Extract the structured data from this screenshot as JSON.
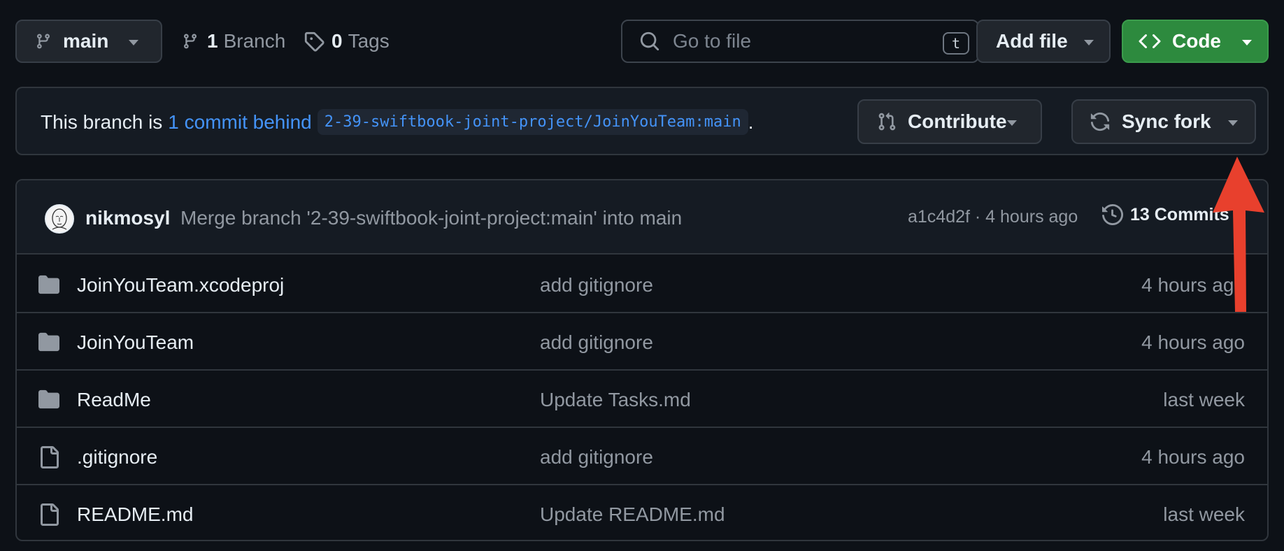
{
  "toolbar": {
    "branch": {
      "label": "main",
      "icon": "git-branch-icon"
    },
    "branches": {
      "count": "1",
      "label": "Branch",
      "icon": "git-branch-icon"
    },
    "tags": {
      "count": "0",
      "label": "Tags",
      "icon": "tag-icon"
    },
    "search": {
      "placeholder": "Go to file",
      "shortcut": "t",
      "icon": "search-icon"
    },
    "add_file": {
      "label": "Add file"
    },
    "code": {
      "label": "Code",
      "icon": "code-icon",
      "color": "#2d8a3e"
    }
  },
  "branch_status": {
    "prefix": "This branch is",
    "link": "1 commit behind",
    "upstream": "2-39-swiftbook-joint-project/JoinYouTeam:main",
    "suffix": ".",
    "contribute": {
      "label": "Contribute",
      "icon": "git-pull-request-icon"
    },
    "sync": {
      "label": "Sync fork",
      "icon": "sync-icon"
    }
  },
  "latest_commit": {
    "author": "nikmosyl",
    "message": "Merge branch '2-39-swiftbook-joint-project:main' into main",
    "meta": "a1c4d2f · 4 hours ago",
    "commits": {
      "label": "13 Commits",
      "icon": "history-icon"
    }
  },
  "files": [
    {
      "type": "folder",
      "name": "JoinYouTeam.xcodeproj",
      "message": "add gitignore",
      "time": "4 hours ago"
    },
    {
      "type": "folder",
      "name": "JoinYouTeam",
      "message": "add gitignore",
      "time": "4 hours ago"
    },
    {
      "type": "folder",
      "name": "ReadMe",
      "message": "Update Tasks.md",
      "time": "last week"
    },
    {
      "type": "file",
      "name": ".gitignore",
      "message": "add gitignore",
      "time": "4 hours ago"
    },
    {
      "type": "file",
      "name": "README.md",
      "message": "Update README.md",
      "time": "last week"
    }
  ],
  "annotation": {
    "icon": "red-arrow-icon",
    "color": "#e8402d"
  },
  "colors": {
    "background": "#0d1117",
    "accent_link": "#4493f8"
  }
}
